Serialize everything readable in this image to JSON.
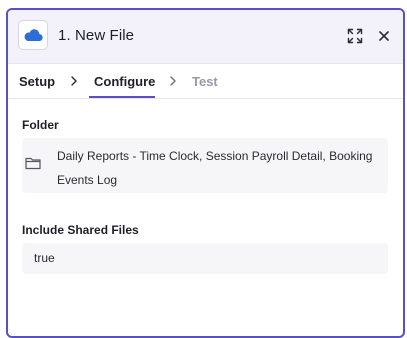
{
  "header": {
    "title": "1. New File",
    "app_icon": "cloud-icon",
    "expand_icon": "expand-icon",
    "close_icon": "close-icon"
  },
  "tabs": [
    {
      "label": "Setup",
      "state": "completed"
    },
    {
      "label": "Configure",
      "state": "active"
    },
    {
      "label": "Test",
      "state": "disabled"
    }
  ],
  "fields": {
    "folder": {
      "label": "Folder",
      "value": "Daily Reports - Time Clock, Session Payroll Detail, Booking Events Log",
      "icon": "folder-icon"
    },
    "include_shared": {
      "label": "Include Shared Files",
      "value": "true"
    }
  },
  "colors": {
    "accent": "#5b4fc4",
    "app_icon": "#2b6fd6",
    "header_bg": "#f3f2fb",
    "field_bg": "#f6f6f8"
  }
}
